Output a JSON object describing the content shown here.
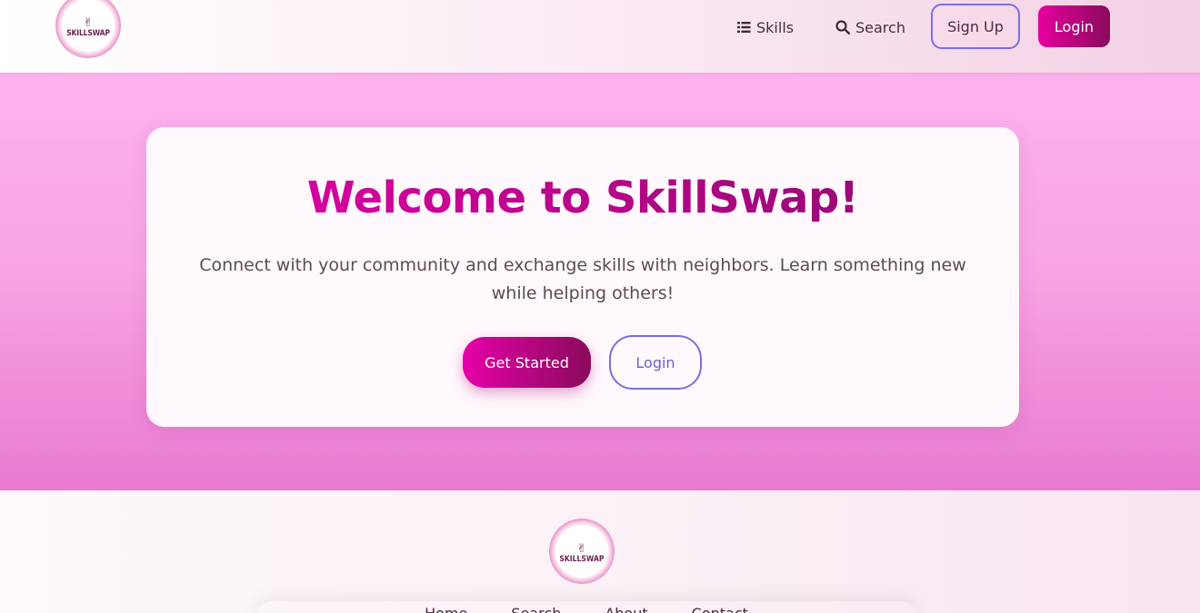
{
  "header": {
    "logo_text": "SKILLSWAP",
    "nav": [
      {
        "label": "Skills",
        "icon": "list-icon"
      },
      {
        "label": "Search",
        "icon": "search-icon"
      }
    ],
    "signup_label": "Sign Up",
    "login_label": "Login"
  },
  "hero": {
    "title": "Welcome to SkillSwap!",
    "subtitle": "Connect with your community and exchange skills with neighbors. Learn something new while helping others!",
    "get_started_label": "Get Started",
    "login_label": "Login"
  },
  "footer": {
    "logo_text": "SKILLSWAP",
    "links": [
      "Home",
      "Search",
      "About",
      "Contact"
    ]
  },
  "colors": {
    "accent": "#e600a8",
    "accent_dark": "#8a0a5c",
    "outline": "#7b6fe0",
    "hero_bg": "#fcb2ee"
  }
}
